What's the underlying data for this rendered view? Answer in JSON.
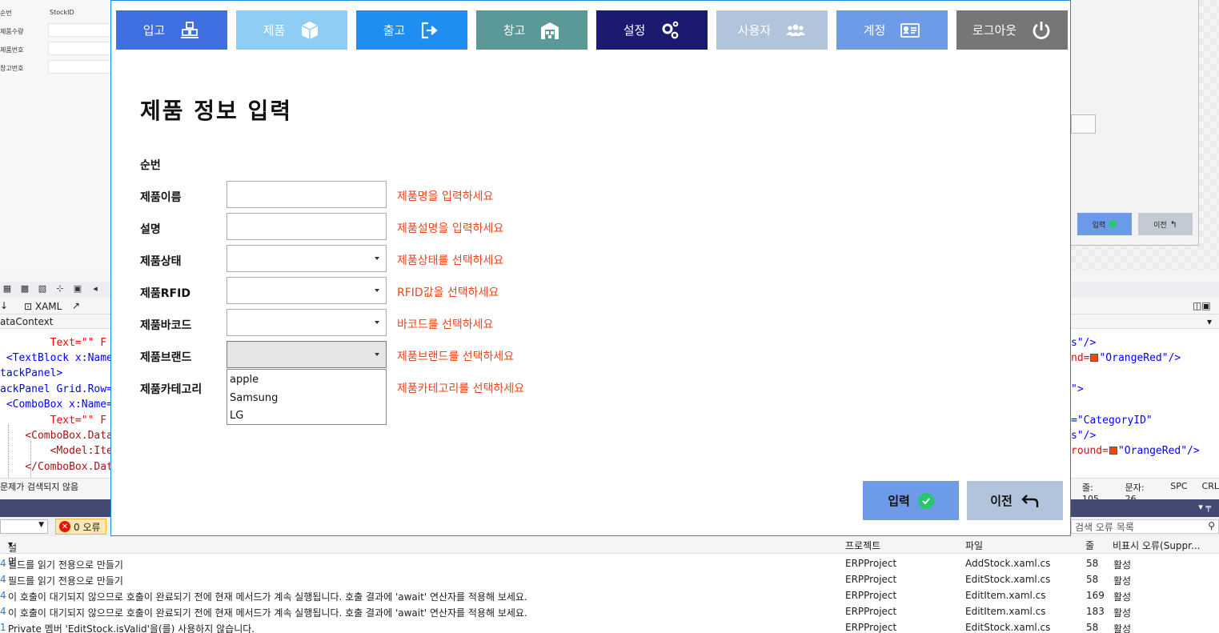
{
  "designer": {
    "left_form": {
      "labels": [
        "순번",
        "제품수량",
        "제품번호",
        "창고번호"
      ],
      "column_header": "StockID"
    },
    "mini_buttons": {
      "submit": "입력",
      "back": "이전"
    }
  },
  "ide": {
    "xaml_tab": "XAML",
    "data_context": "ataContext",
    "code_lines_left": [
      "        Text=\"\" F",
      " <TextBlock x:Name=",
      "tackPanel>",
      "ackPanel Grid.Row=\"",
      " <ComboBox x:Name=\"",
      "        Text=\"\" F",
      "    <ComboBox.Data",
      "        <Model:Ite",
      "    </ComboBox.Dat"
    ],
    "code_lines_right": {
      "r1": "s\"/>",
      "r2_prefix": "nd=",
      "r2_value": "\"OrangeRed\"/>",
      "r3": "\">",
      "r4": "=\"CategoryID\"",
      "r5": "s\"/>",
      "r6_prefix": "round=",
      "r6_value": "\"OrangeRed\"/>"
    },
    "status_left": "문제가 검색되지 않음",
    "status_right": {
      "line": "줄: 105",
      "char": "문자: 26",
      "spc": "SPC",
      "crlf": "CRL"
    }
  },
  "error_list": {
    "error_count": "0 오류",
    "search_placeholder": "검색 오류 목록",
    "columns": {
      "desc": "설명",
      "project": "프로젝트",
      "file": "파일",
      "line": "줄",
      "suppression": "비표시 오류(Suppr..."
    },
    "rows": [
      {
        "num": "4",
        "desc": "필드를 읽기 전용으로 만들기",
        "project": "ERPProject",
        "file": "AddStock.xaml.cs",
        "line": "58",
        "state": "활성"
      },
      {
        "num": "4",
        "desc": "필드를 읽기 전용으로 만들기",
        "project": "ERPProject",
        "file": "EditStock.xaml.cs",
        "line": "58",
        "state": "활성"
      },
      {
        "num": "4",
        "desc": "이 호출이 대기되지 않으므로 호출이 완료되기 전에 현재 메서드가 계속 실행됩니다. 호출 결과에 'await' 연산자를 적용해 보세요.",
        "project": "ERPProject",
        "file": "EditItem.xaml.cs",
        "line": "169",
        "state": "활성"
      },
      {
        "num": "4",
        "desc": "이 호출이 대기되지 않으므로 호출이 완료되기 전에 현재 메서드가 계속 실행됩니다. 호출 결과에 'await' 연산자를 적용해 보세요.",
        "project": "ERPProject",
        "file": "EditItem.xaml.cs",
        "line": "183",
        "state": "활성"
      },
      {
        "num": "1",
        "desc": "Private 멤버 'EditStock.isValid'을(를) 사용하지 않습니다.",
        "project": "ERPProject",
        "file": "EditStock.xaml.cs",
        "line": "58",
        "state": "활성"
      }
    ]
  },
  "nav": [
    {
      "label": "입고",
      "icon": "boxes-icon",
      "color": "#3f6fe0"
    },
    {
      "label": "제품",
      "icon": "box-icon",
      "color": "#8fcdf5"
    },
    {
      "label": "출고",
      "icon": "sign-out-icon",
      "color": "#1e8ef2"
    },
    {
      "label": "창고",
      "icon": "warehouse-icon",
      "color": "#5b9998"
    },
    {
      "label": "설정",
      "icon": "gears-icon",
      "color": "#1a1a6e"
    },
    {
      "label": "사용자",
      "icon": "users-icon",
      "color": "#b2c3dc"
    },
    {
      "label": "계정",
      "icon": "id-card-icon",
      "color": "#6d9be8"
    },
    {
      "label": "로그아웃",
      "icon": "power-icon",
      "color": "#767676"
    }
  ],
  "form": {
    "title": "제품 정보 입력",
    "fields": {
      "seq": {
        "label": "순번"
      },
      "name": {
        "label": "제품이름",
        "hint": "제품명을 입력하세요",
        "value": ""
      },
      "desc": {
        "label": "설명",
        "hint": "제품설명을 입력하세요",
        "value": ""
      },
      "status": {
        "label": "제품상태",
        "hint": "제품상태를 선택하세요",
        "selected": ""
      },
      "rfid": {
        "label": "제품RFID",
        "hint": "RFID값을 선택하세요",
        "selected": ""
      },
      "barcode": {
        "label": "제품바코드",
        "hint": "바코드를 선택하세요",
        "selected": ""
      },
      "brand": {
        "label": "제품브랜드",
        "hint": "제품브랜드를 선택하세요",
        "selected": "",
        "options": [
          "apple",
          "Samsung",
          "LG"
        ]
      },
      "category": {
        "label": "제품카테고리",
        "hint": "제품카테고리를 선택하세요"
      }
    },
    "buttons": {
      "submit": {
        "label": "입력",
        "color": "#6d9be8"
      },
      "back": {
        "label": "이전",
        "color": "#b2c3dc"
      }
    },
    "hint_color": "#e8471f"
  }
}
